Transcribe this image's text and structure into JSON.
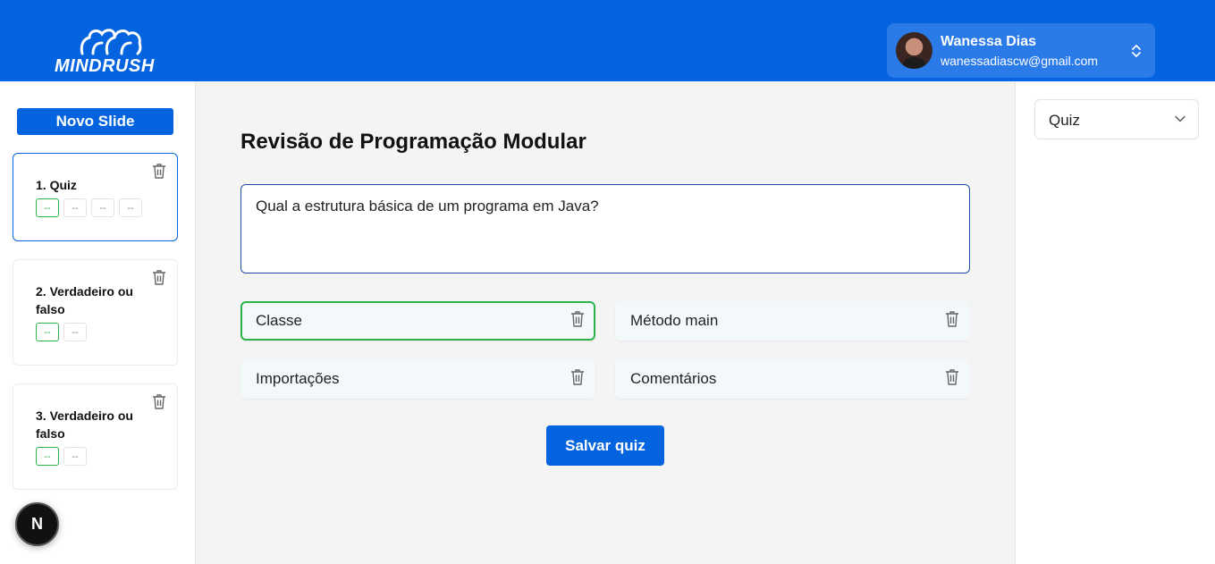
{
  "header": {
    "logo_text": "MINDRUSH",
    "user": {
      "name": "Wanessa Dias",
      "email": "wanessadiascw@gmail.com"
    }
  },
  "sidebar": {
    "new_slide_label": "Novo Slide",
    "slides": [
      {
        "title": "1. Quiz",
        "options": [
          "--",
          "--",
          "--",
          "--"
        ],
        "correct_index": 0,
        "active": true
      },
      {
        "title": "2. Verdadeiro ou falso",
        "options": [
          "--",
          "--"
        ],
        "correct_index": 0,
        "active": false
      },
      {
        "title": "3. Verdadeiro ou falso",
        "options": [
          "--",
          "--"
        ],
        "correct_index": 0,
        "active": false
      }
    ],
    "next_badge": "N"
  },
  "main": {
    "title": "Revisão de Programação Modular",
    "question": "Qual a estrutura básica de um programa em Java?",
    "answers": [
      {
        "text": "Classe",
        "correct": true
      },
      {
        "text": "Método main",
        "correct": false
      },
      {
        "text": "Importações",
        "correct": false
      },
      {
        "text": "Comentários",
        "correct": false
      }
    ],
    "save_label": "Salvar quiz"
  },
  "right_panel": {
    "slide_type": "Quiz"
  },
  "colors": {
    "brand_blue": "#0463de",
    "correct_green": "#2bb34a"
  }
}
